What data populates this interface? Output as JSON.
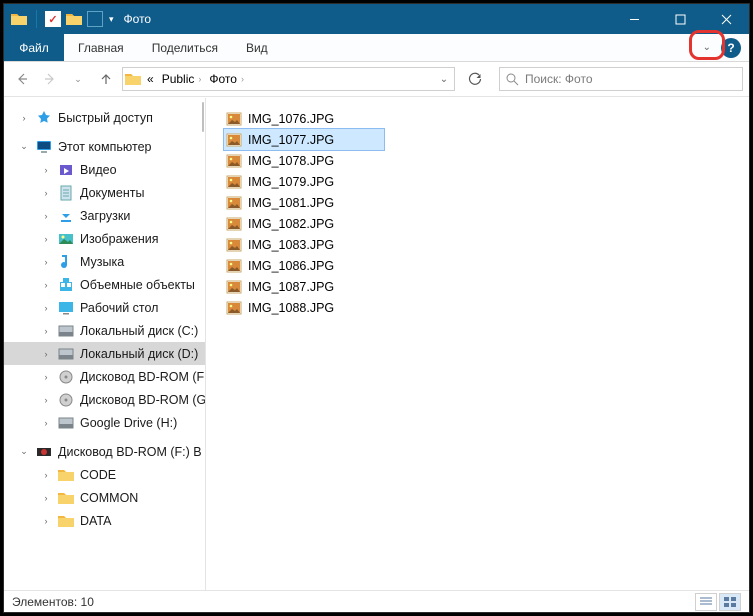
{
  "titlebar": {
    "title": "Фото"
  },
  "ribbon": {
    "file": "Файл",
    "tabs": [
      "Главная",
      "Поделиться",
      "Вид"
    ]
  },
  "address": {
    "prefix": "«",
    "crumbs": [
      "Public",
      "Фото"
    ]
  },
  "search": {
    "placeholder": "Поиск: Фото"
  },
  "tree": {
    "quick_access": "Быстрый доступ",
    "this_pc": "Этот компьютер",
    "pc_children": [
      "Видео",
      "Документы",
      "Загрузки",
      "Изображения",
      "Музыка",
      "Объемные объекты",
      "Рабочий стол",
      "Локальный диск (C:)",
      "Локальный диск (D:)",
      "Дисковод BD-ROM (F:)",
      "Дисковод BD-ROM (G:)",
      "Google Drive (H:)"
    ],
    "bd_f": "Дисковод BD-ROM (F:) B",
    "bd_children": [
      "CODE",
      "COMMON",
      "DATA"
    ]
  },
  "files": [
    "IMG_1076.JPG",
    "IMG_1077.JPG",
    "IMG_1078.JPG",
    "IMG_1079.JPG",
    "IMG_1081.JPG",
    "IMG_1082.JPG",
    "IMG_1083.JPG",
    "IMG_1086.JPG",
    "IMG_1087.JPG",
    "IMG_1088.JPG"
  ],
  "selected_file_index": 1,
  "status": {
    "count_label": "Элементов: 10"
  }
}
